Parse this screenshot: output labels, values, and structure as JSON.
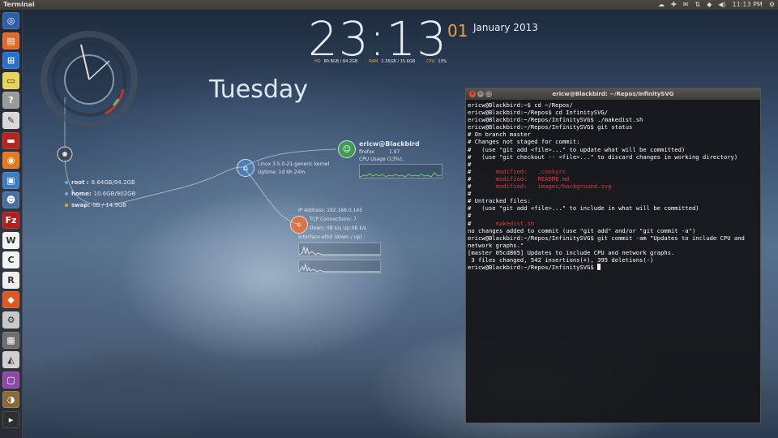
{
  "top_panel": {
    "title": "Terminal",
    "tray": {
      "time": "11:13 PM",
      "icons": [
        "dropbox-icon",
        "network-icon",
        "mail-icon",
        "keyboard-icon",
        "wifi-icon",
        "volume-icon",
        "session-gear-icon"
      ]
    }
  },
  "launcher": {
    "items": [
      {
        "name": "ubuntu-dash-icon",
        "glyph": "◎",
        "color": "#2d5fa8"
      },
      {
        "name": "files-icon",
        "glyph": "▤",
        "color": "#e06a2c"
      },
      {
        "name": "sysmonitor-icon",
        "glyph": "⊞",
        "color": "#2a6fc9"
      },
      {
        "name": "notes-icon",
        "glyph": "▭",
        "color": "#e8d35a"
      },
      {
        "name": "help-icon",
        "glyph": "?",
        "color": "#9a9a9a"
      },
      {
        "name": "text-editor-icon",
        "glyph": "✎",
        "color": "#d8d8d8"
      },
      {
        "name": "terminal-red-icon",
        "glyph": "▬",
        "color": "#b3261e"
      },
      {
        "name": "firefox-icon",
        "glyph": "◉",
        "color": "#e47a1c"
      },
      {
        "name": "remote-desktop-icon",
        "glyph": "▣",
        "color": "#3a7dc0"
      },
      {
        "name": "xchat-icon",
        "glyph": "☻",
        "color": "#4a6fa0"
      },
      {
        "name": "filezilla-icon",
        "glyph": "Fz",
        "color": "#b51e1e"
      },
      {
        "name": "libreoffice-writer-icon",
        "glyph": "W",
        "color": "#f2f2f2"
      },
      {
        "name": "libreoffice-calc-icon",
        "glyph": "C",
        "color": "#f2f2f2"
      },
      {
        "name": "rstudio-icon",
        "glyph": "R",
        "color": "#f0f0f0"
      },
      {
        "name": "software-center-icon",
        "glyph": "◆",
        "color": "#e0581f"
      },
      {
        "name": "settings-icon",
        "glyph": "⚙",
        "color": "#c8c8c8"
      },
      {
        "name": "workspace-switcher-icon",
        "glyph": "▦",
        "color": "#6e6e6e"
      },
      {
        "name": "inkscape-icon",
        "glyph": "◭",
        "color": "#d0d0d0"
      },
      {
        "name": "display-icon",
        "glyph": "▢",
        "color": "#9048a8"
      },
      {
        "name": "gimp-icon",
        "glyph": "◑",
        "color": "#8a6a3a"
      },
      {
        "name": "terminal-icon",
        "glyph": "▸",
        "color": "#2f2f2f"
      }
    ]
  },
  "clock": {
    "time": "23:13",
    "seconds": "01",
    "month_year": "January 2013",
    "stats": [
      {
        "label": "HD",
        "value": "80.8GB / 84.2GB"
      },
      {
        "label": "RAM",
        "value": "2.35GB / 15.6GB"
      },
      {
        "label": "CPU",
        "value": "13%"
      }
    ],
    "day": "Tuesday"
  },
  "disks": [
    {
      "label": "root :",
      "value": "8.64GB/94.2GB"
    },
    {
      "label": "home:",
      "value": "10.6GB/902GB"
    },
    {
      "label": "swap:",
      "value": "0B  / 14.9GB"
    }
  ],
  "system": {
    "kernel": "Linux 3.5.0-21-generic kernel",
    "uptime": "Uptime: 1d 6h 24m"
  },
  "user": {
    "name": "ericw@Blackbird",
    "process": "firefox",
    "process_value": "1.97",
    "cpu_usage": "CPU Usage (13%):"
  },
  "network": {
    "ip": "IP Address: 192.168.0.145",
    "tcp": "TCP Connections: 7",
    "speed": "Down: 0B  k/s    Up:0B  k/s",
    "iface": "Interface eth0 (down / up) :"
  },
  "terminal": {
    "title": "ericw@Blackbird: ~/Repos/InfinitySVG",
    "lines": [
      {
        "t": "ericw@Blackbird:~$ cd ~/Repos/"
      },
      {
        "t": "ericw@Blackbird:~/Repos$ cd InfinitySVG/"
      },
      {
        "t": "ericw@Blackbird:~/Repos/InfinitySVG$ ./makedist.sh"
      },
      {
        "t": "ericw@Blackbird:~/Repos/InfinitySVG$ git status"
      },
      {
        "t": "# On branch master"
      },
      {
        "t": "# Changes not staged for commit:"
      },
      {
        "t": "#   (use \"git add <file>...\" to update what will be committed)"
      },
      {
        "t": "#   (use \"git checkout -- <file>...\" to discard changes in working directory)"
      },
      {
        "t": "#"
      },
      {
        "t": "#\tmodified:   .conkyrc",
        "red": "modified:   .conkyrc"
      },
      {
        "t": "#\tmodified:   README.md",
        "red": "modified:   README.md"
      },
      {
        "t": "#\tmodified:   images/background.svg",
        "red": "modified:   images/background.svg"
      },
      {
        "t": "#"
      },
      {
        "t": "# Untracked files:"
      },
      {
        "t": "#   (use \"git add <file>...\" to include in what will be committed)"
      },
      {
        "t": "#"
      },
      {
        "t": "#\tmakedist.sh",
        "red": "makedist.sh"
      },
      {
        "t": "no changes added to commit (use \"git add\" and/or \"git commit -a\")"
      },
      {
        "t": "ericw@Blackbird:~/Repos/InfinitySVG$ git commit -am \"Updates to include CPU and"
      },
      {
        "t": "network graphs.\""
      },
      {
        "t": "[master 05cd865] Updates to include CPU and network graphs."
      },
      {
        "t": " 3 files changed, 542 insertions(+), 395 deletions(-)"
      },
      {
        "t": "ericw@Blackbird:~/Repos/InfinitySVG$ ",
        "cursor": true
      }
    ]
  }
}
